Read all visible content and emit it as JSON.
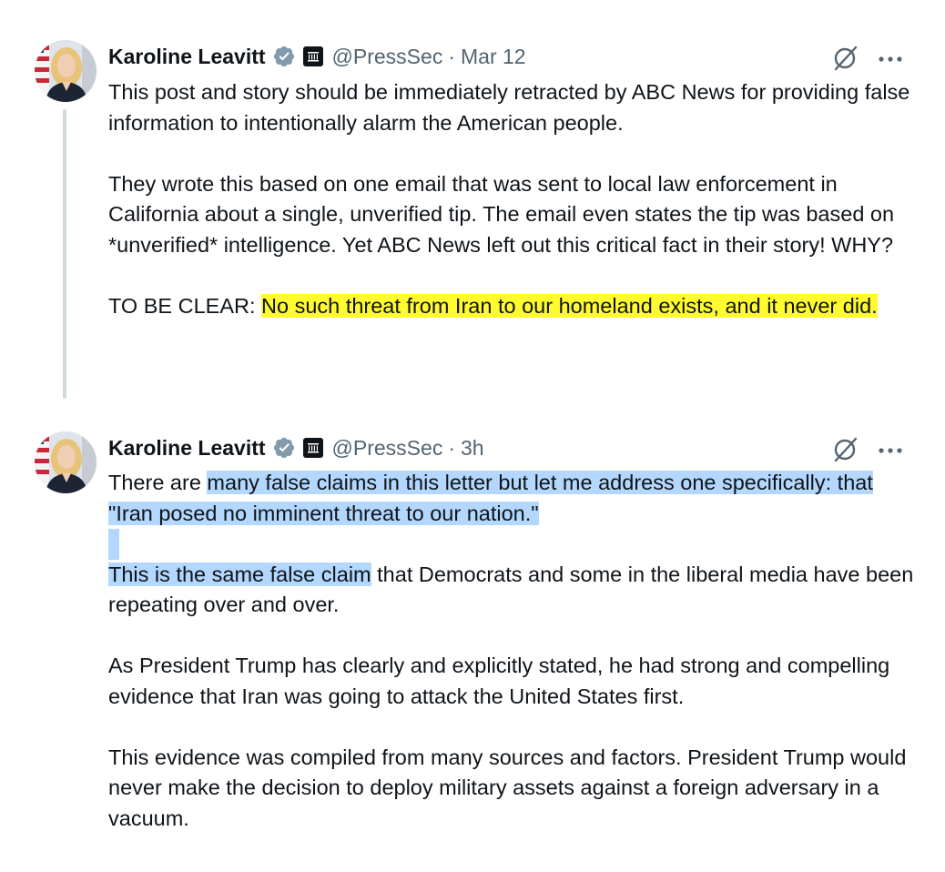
{
  "tweets": [
    {
      "author_name": "Karoline Leavitt",
      "handle": "@PressSec",
      "separator": "·",
      "time": "Mar 12",
      "avatar": "avatar-photo",
      "icons": [
        "verified-badge-icon",
        "white-house-affiliate-icon",
        "grok-icon",
        "more-icon"
      ],
      "p1": "This post and story should be immediately retracted by ABC News for providing false information to intentionally alarm the American people.",
      "p2": "They wrote this based on one email that was sent to local law enforcement in California about a single, unverified tip. The email even states the tip was based on *unverified* intelligence. Yet ABC News left out this critical fact in their story! WHY?",
      "p3_lead": "TO BE CLEAR: ",
      "p3_highlight": "No such threat from Iran to our homeland exists, and it never did."
    },
    {
      "author_name": "Karoline Leavitt",
      "handle": "@PressSec",
      "separator": "·",
      "time": "3h",
      "avatar": "avatar-photo",
      "icons": [
        "verified-badge-icon",
        "white-house-affiliate-icon",
        "grok-icon",
        "more-icon"
      ],
      "p1_lead": "There are ",
      "p1_selected": "many false claims in this letter but let me address one specifically: that \"Iran posed no imminent threat to our nation.\"",
      "p2_selected": "This is the same false claim",
      "p2_rest": " that Democrats and some in the liberal media have been repeating over and over.",
      "p3": "As President Trump has clearly and explicitly stated, he had strong and compelling evidence that Iran was going to attack the United States first.",
      "p4": "This evidence was compiled from many sources and factors. President Trump would never make the decision to deploy military assets against a foreign adversary in a vacuum."
    }
  ],
  "colors": {
    "text": "#0f1419",
    "secondary_text": "#536471",
    "verified_badge": "#829aab",
    "thread_line": "#cfd9de",
    "highlight_yellow": "#fffb2e",
    "selection_blue": "#b3d7fd"
  }
}
